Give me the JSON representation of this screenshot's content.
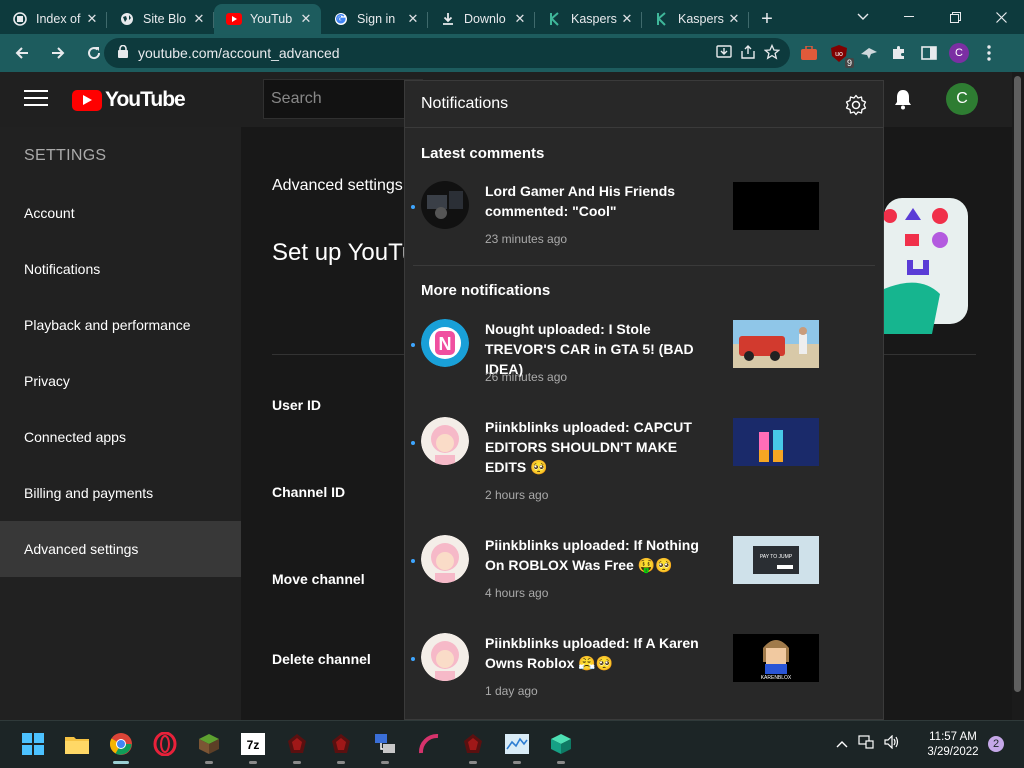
{
  "browser": {
    "tabs": [
      {
        "title": "Index of",
        "icon": "server-icon"
      },
      {
        "title": "Site Blo",
        "icon": "globe-icon"
      },
      {
        "title": "YouTub",
        "icon": "youtube-icon",
        "active": true
      },
      {
        "title": "Sign in",
        "icon": "google-icon"
      },
      {
        "title": "Downlo",
        "icon": "download-icon"
      },
      {
        "title": "Kaspers",
        "icon": "kaspersky-icon"
      },
      {
        "title": "Kaspers",
        "icon": "kaspersky-icon"
      }
    ],
    "new_tab": "+",
    "url": "youtube.com/account_advanced",
    "extension_badge": "9",
    "profile_initial": "C",
    "accent_color": "#1d5c5e"
  },
  "youtube": {
    "logo_text": "YouTube",
    "search_placeholder": "Search",
    "avatar_initial": "C",
    "settings_heading": "SETTINGS",
    "sidebar": [
      {
        "label": "Account"
      },
      {
        "label": "Notifications"
      },
      {
        "label": "Playback and performance"
      },
      {
        "label": "Privacy"
      },
      {
        "label": "Connected apps"
      },
      {
        "label": "Billing and payments"
      },
      {
        "label": "Advanced settings",
        "selected": true
      }
    ],
    "main": {
      "title": "Advanced settings",
      "setup_text": "Set up YouTu",
      "fields": [
        "User ID",
        "Channel ID",
        "Move channel",
        "Delete channel"
      ]
    }
  },
  "notifications": {
    "title": "Notifications",
    "latest_heading": "Latest comments",
    "more_heading": "More notifications",
    "latest": [
      {
        "text": "Lord Gamer And His Friends commented: \"Cool\"",
        "time": "23 minutes ago"
      }
    ],
    "more": [
      {
        "text": "Nought uploaded: I Stole TREVOR'S CAR in GTA 5! (BAD IDEA)",
        "time": "26 minutes ago"
      },
      {
        "text": "Piinkblinks uploaded: CAPCUT EDITORS SHOULDN'T MAKE EDITS 🥺",
        "time": "2 hours ago"
      },
      {
        "text": "Piinkblinks uploaded: If Nothing On ROBLOX Was Free 🤑🥺",
        "time": "4 hours ago"
      },
      {
        "text": "Piinkblinks uploaded: If A Karen Owns Roblox 😤🥺",
        "time": "1 day ago"
      }
    ],
    "thumb_texts": {
      "thumb3": "PAY TO JUMP",
      "thumb4": "KARENBLOX"
    }
  },
  "taskbar": {
    "time": "11:57 AM",
    "date": "3/29/2022",
    "notification_count": "2"
  }
}
